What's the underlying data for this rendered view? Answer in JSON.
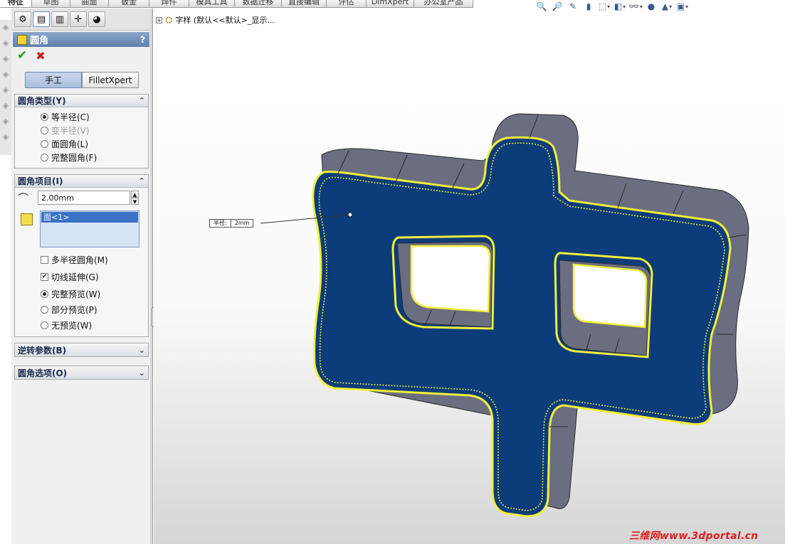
{
  "top_tabs": [
    "特征",
    "草图",
    "曲面",
    "钣金",
    "焊件",
    "模具工具",
    "数据迁移",
    "直接编辑",
    "评估",
    "DimXpert",
    "办公室产品"
  ],
  "view_toolbar": [
    {
      "icon": "zoom-to-fit-icon",
      "glyph": "🔍",
      "dropdown": false
    },
    {
      "icon": "zoom-area-icon",
      "glyph": "🔎",
      "dropdown": false
    },
    {
      "icon": "previous-view-icon",
      "glyph": "✎",
      "dropdown": false
    },
    {
      "icon": "section-view-icon",
      "glyph": "▮",
      "dropdown": false
    },
    {
      "icon": "view-orientation-icon",
      "glyph": "⬚",
      "dropdown": true
    },
    {
      "icon": "display-style-icon",
      "glyph": "◧",
      "dropdown": true
    },
    {
      "icon": "hide-show-items-icon",
      "glyph": "👓",
      "dropdown": true
    },
    {
      "icon": "edit-appearance-icon",
      "glyph": "●",
      "dropdown": false
    },
    {
      "icon": "apply-scene-icon",
      "glyph": "▲",
      "dropdown": true
    },
    {
      "icon": "view-settings-icon",
      "glyph": "▣",
      "dropdown": true
    }
  ],
  "pm_tabs": [
    {
      "icon": "feature-manager-icon",
      "glyph": "⚙"
    },
    {
      "icon": "property-manager-icon",
      "glyph": "▤"
    },
    {
      "icon": "configuration-manager-icon",
      "glyph": "▥"
    },
    {
      "icon": "dimxpert-manager-icon",
      "glyph": "✛"
    },
    {
      "icon": "display-manager-icon",
      "glyph": "◕"
    }
  ],
  "pm_title": "圆角",
  "pm_help": "?",
  "mode_buttons": {
    "manual": "手工",
    "filletxpert": "FilletXpert"
  },
  "fillet_type": {
    "title": "圆角类型(Y)",
    "options": [
      {
        "label": "等半径(C)",
        "selected": true,
        "disabled": false
      },
      {
        "label": "变半径(V)",
        "selected": false,
        "disabled": true
      },
      {
        "label": "面圆角(L)",
        "selected": false,
        "disabled": false
      },
      {
        "label": "完整圆角(F)",
        "selected": false,
        "disabled": false
      }
    ]
  },
  "fillet_items": {
    "title": "圆角项目(I)",
    "radius": "2.00mm",
    "selection": "面<1>",
    "multi_radius": {
      "label": "多半径圆角(M)",
      "checked": false
    },
    "tangent_propagation": {
      "label": "切线延伸(G)",
      "checked": true
    },
    "preview_options": [
      {
        "label": "完整预览(W)",
        "selected": true
      },
      {
        "label": "部分预览(P)",
        "selected": false
      },
      {
        "label": "无预览(W)",
        "selected": false
      }
    ]
  },
  "setback_params": {
    "title": "逆转参数(B)"
  },
  "fillet_options": {
    "title": "圆角选项(O)"
  },
  "tree_text": "字样 (默认<<默认>_显示...",
  "callout": {
    "label": "半径:",
    "value": "2mm"
  },
  "watermark": "三维网www.3dportal.cn",
  "colors": {
    "model_face": "#0c3d7a",
    "model_side": "#6a6e80",
    "fillet_preview": "#f2ef3a",
    "title_bar": "#6a8ab8"
  }
}
